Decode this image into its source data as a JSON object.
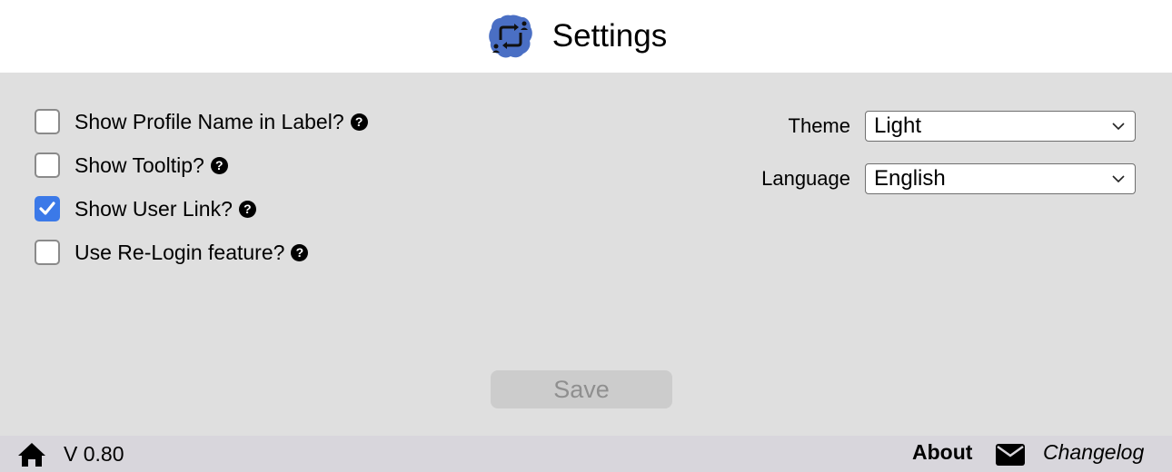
{
  "header": {
    "title": "Settings",
    "logo_icon": "profile-switch-logo"
  },
  "options": [
    {
      "label": "Show Profile Name in Label?",
      "checked": false
    },
    {
      "label": "Show Tooltip?",
      "checked": false
    },
    {
      "label": "Show User Link?",
      "checked": true
    },
    {
      "label": "Use Re-Login feature?",
      "checked": false
    }
  ],
  "fields": {
    "theme": {
      "label": "Theme",
      "value": "Light"
    },
    "language": {
      "label": "Language",
      "value": "English"
    }
  },
  "save_label": "Save",
  "footer": {
    "version": "V 0.80",
    "about": "About",
    "changelog": "Changelog"
  },
  "colors": {
    "accent": "#3b79e8",
    "logo_blue": "#4a6fc4"
  }
}
